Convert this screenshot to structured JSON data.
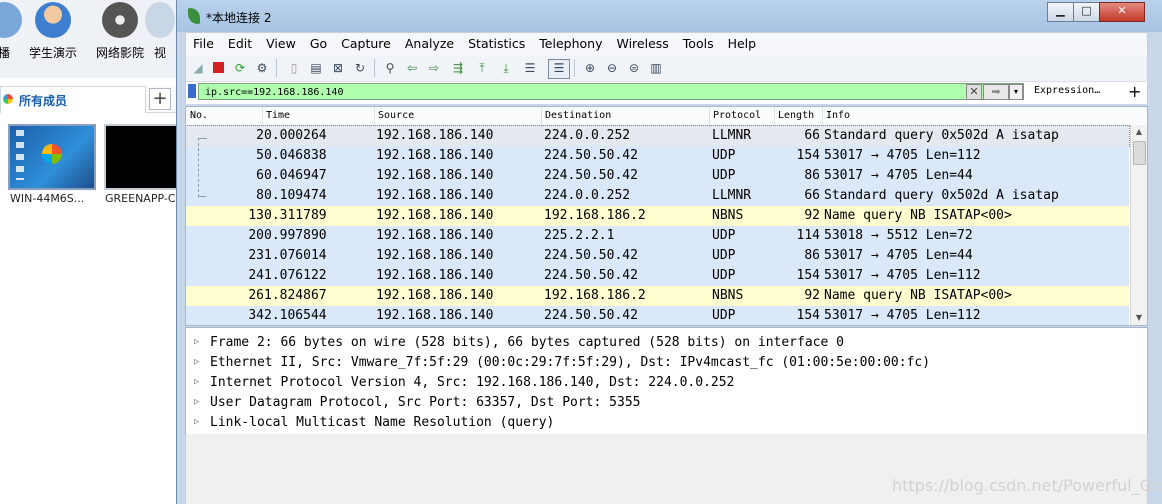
{
  "background_app": {
    "tools": [
      {
        "label": "播",
        "icon": "broadcast-icon"
      },
      {
        "label": "学生演示",
        "icon": "student-demo-icon"
      },
      {
        "label": "网络影院",
        "icon": "film-reel-icon"
      },
      {
        "label": "视",
        "icon": "video-icon"
      }
    ],
    "members_tab": "所有成员",
    "add_tab": "+",
    "thumbnails": [
      {
        "label": "WIN-44M6S..."
      },
      {
        "label": "GREENAPP-C"
      }
    ]
  },
  "window": {
    "title": "*本地连接 2",
    "controls": {
      "minimize": "▁",
      "maximize": "□",
      "close": "✕"
    }
  },
  "menu": [
    "File",
    "Edit",
    "View",
    "Go",
    "Capture",
    "Analyze",
    "Statistics",
    "Telephony",
    "Wireless",
    "Tools",
    "Help"
  ],
  "toolbar_icons": [
    "shark-fin-start-icon",
    "stop-icon",
    "restart-icon",
    "options-icon",
    "open-file-icon",
    "save-file-icon",
    "close-file-icon",
    "reload-icon",
    "find-icon",
    "back-icon",
    "forward-icon",
    "go-to-packet-icon",
    "first-packet-icon",
    "last-packet-icon",
    "autoscroll-icon",
    "colorize-icon",
    "zoom-in-icon",
    "zoom-out-icon",
    "normal-size-icon",
    "resize-columns-icon"
  ],
  "filter": {
    "value": "ip.src==192.168.186.140",
    "expression_label": "Expression…",
    "plus_label": "+",
    "clear_label": "✕",
    "apply_label": "➡",
    "dropdown_label": "▾"
  },
  "packet_list": {
    "columns": [
      "No.",
      "Time",
      "Source",
      "Destination",
      "Protocol",
      "Length",
      "Info"
    ],
    "rows": [
      {
        "no": "2",
        "time": "0.000264",
        "src": "192.168.186.140",
        "dst": "224.0.0.252",
        "proto": "LLMNR",
        "len": "66",
        "info": "Standard query 0x502d A isatap",
        "color": "#e4e9ef"
      },
      {
        "no": "5",
        "time": "0.046838",
        "src": "192.168.186.140",
        "dst": "224.50.50.42",
        "proto": "UDP",
        "len": "154",
        "info": "53017 → 4705 Len=112",
        "color": "#dae8fa"
      },
      {
        "no": "6",
        "time": "0.046947",
        "src": "192.168.186.140",
        "dst": "224.50.50.42",
        "proto": "UDP",
        "len": "86",
        "info": "53017 → 4705 Len=44",
        "color": "#dae8fa"
      },
      {
        "no": "8",
        "time": "0.109474",
        "src": "192.168.186.140",
        "dst": "224.0.0.252",
        "proto": "LLMNR",
        "len": "66",
        "info": "Standard query 0x502d A isatap",
        "color": "#dae8fa"
      },
      {
        "no": "13",
        "time": "0.311789",
        "src": "192.168.186.140",
        "dst": "192.168.186.2",
        "proto": "NBNS",
        "len": "92",
        "info": "Name query NB ISATAP<00>",
        "color": "#fefed0"
      },
      {
        "no": "20",
        "time": "0.997890",
        "src": "192.168.186.140",
        "dst": "225.2.2.1",
        "proto": "UDP",
        "len": "114",
        "info": "53018 → 5512 Len=72",
        "color": "#dae8fa"
      },
      {
        "no": "23",
        "time": "1.076014",
        "src": "192.168.186.140",
        "dst": "224.50.50.42",
        "proto": "UDP",
        "len": "86",
        "info": "53017 → 4705 Len=44",
        "color": "#dae8fa"
      },
      {
        "no": "24",
        "time": "1.076122",
        "src": "192.168.186.140",
        "dst": "224.50.50.42",
        "proto": "UDP",
        "len": "154",
        "info": "53017 → 4705 Len=112",
        "color": "#dae8fa"
      },
      {
        "no": "26",
        "time": "1.824867",
        "src": "192.168.186.140",
        "dst": "192.168.186.2",
        "proto": "NBNS",
        "len": "92",
        "info": "Name query NB ISATAP<00>",
        "color": "#fefed0"
      },
      {
        "no": "34",
        "time": "2.106544",
        "src": "192.168.186.140",
        "dst": "224.50.50.42",
        "proto": "UDP",
        "len": "154",
        "info": "53017 → 4705 Len=112",
        "color": "#dae8fa"
      }
    ]
  },
  "details": [
    "Frame 2: 66 bytes on wire (528 bits), 66 bytes captured (528 bits) on interface 0",
    "Ethernet II, Src: Vmware_7f:5f:29 (00:0c:29:7f:5f:29), Dst: IPv4mcast_fc (01:00:5e:00:00:fc)",
    "Internet Protocol Version 4, Src: 192.168.186.140, Dst: 224.0.0.252",
    "User Datagram Protocol, Src Port: 63357, Dst Port: 5355",
    "Link-local Multicast Name Resolution (query)"
  ],
  "watermark": "https://blog.csdn.net/Powerful_Green"
}
